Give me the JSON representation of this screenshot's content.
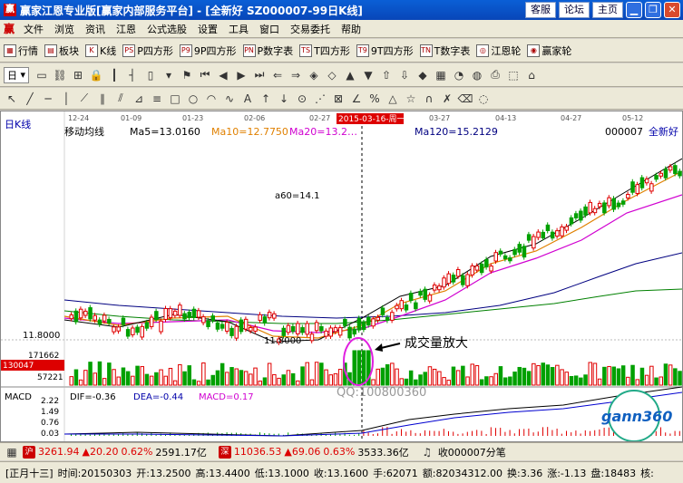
{
  "window": {
    "logo": "赢",
    "title": "赢家江恩专业版[赢家内部服务平台] - [全新好  SZ000007-99日K线]",
    "buttons": [
      "客服",
      "论坛",
      "主页"
    ]
  },
  "menu": {
    "logo": "赢",
    "items": [
      "文件",
      "浏览",
      "资讯",
      "江恩",
      "公式选股",
      "设置",
      "工具",
      "窗口",
      "交易委托",
      "帮助"
    ]
  },
  "toolbar1": {
    "items": [
      {
        "icon": "▦",
        "label": "行情"
      },
      {
        "icon": "▤",
        "label": "板块"
      },
      {
        "icon": "K",
        "label": "K线"
      },
      {
        "icon": "PS",
        "label": "P四方形"
      },
      {
        "icon": "P9",
        "label": "9P四方形"
      },
      {
        "icon": "PN",
        "label": "P数字表"
      },
      {
        "icon": "TS",
        "label": "T四方形"
      },
      {
        "icon": "T9",
        "label": "9T四方形"
      },
      {
        "icon": "TN",
        "label": "T数字表"
      },
      {
        "icon": "◎",
        "label": "江恩轮"
      },
      {
        "icon": "◉",
        "label": "赢家轮"
      }
    ]
  },
  "toolbar2": {
    "period": "日"
  },
  "chart": {
    "panel_title": "日K线",
    "indicator_title": "移动均线",
    "ma5": "Ma5=13.0160",
    "ma10": "Ma10=12.7750",
    "ma20": "Ma20=13.2…",
    "ma120": "Ma120=15.2129",
    "stock_code": "000007",
    "stock_name": "全新好",
    "dates": [
      "12-24",
      "01-09",
      "01-23",
      "02-06",
      "02-27",
      "03-27",
      "04-13",
      "04-27",
      "05-12"
    ],
    "cursor_date": "2015-03-16-周一",
    "price_label": "11.8000",
    "low_label": "11.8000",
    "ma60_label": "a60=14.1",
    "vol_ticks": [
      "171662",
      "130047",
      "57221"
    ],
    "volume_annotation": "成交量放大",
    "qq": "QQ:100800360",
    "macd_label": "MACD",
    "dif": "DIF=-0.36",
    "dea": "DEA=-0.44",
    "macd": "MACD=0.17",
    "macd_ticks": [
      "2.22",
      "1.49",
      "0.76",
      "0.03"
    ],
    "brand": "gann360",
    "colors": {
      "up": "#e00000",
      "down": "#00a000",
      "ma5": "#000000",
      "ma10": "#e08000",
      "ma20": "#d000d0",
      "ma60": "#008000",
      "ma120": "#000080"
    }
  },
  "quotes": {
    "sh_icon": "沪",
    "sh_index": "3261.94",
    "sh_change": "▲20.20",
    "sh_pct": "0.62%",
    "sh_amount": "2591.17亿",
    "sz_icon": "深",
    "sz_index": "11036.53",
    "sz_change": "▲69.06",
    "sz_pct": "0.63%",
    "sz_amount": "3533.36亿",
    "msg": "收000007分笔"
  },
  "status": {
    "lunar": "[正月十三]",
    "time": "时间:20150303",
    "open": "开:13.2500",
    "high": "高:13.4400",
    "low": "低:13.1000",
    "close": "收:13.1600",
    "hand": "手:62071",
    "amount": "额:82034312.00",
    "turnover": "换:3.36",
    "change": "涨:-1.13",
    "pan": "盘:18483",
    "last": "核:"
  }
}
